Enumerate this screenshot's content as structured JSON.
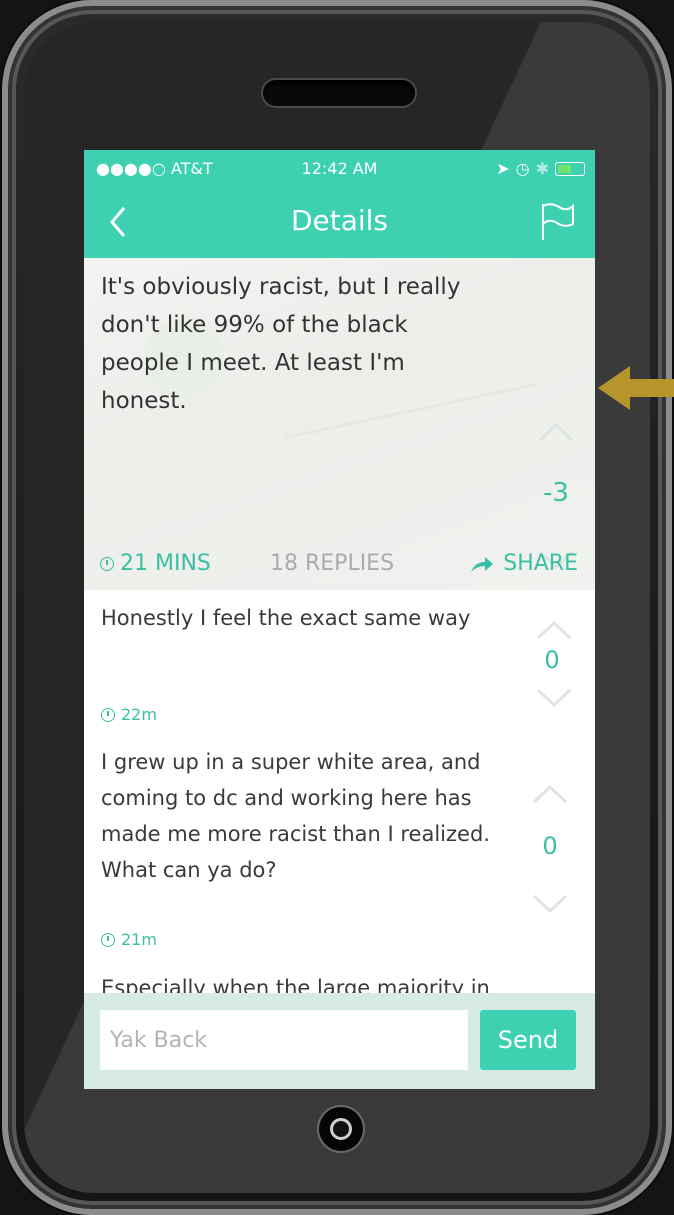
{
  "status_bar": {
    "carrier": "●●●●○ AT&T",
    "time": "12:42 AM"
  },
  "nav": {
    "title": "Details",
    "back_icon": "chevron-left-icon",
    "flag_icon": "flag-icon"
  },
  "post": {
    "text": "It's obviously racist, but I really don't like 99% of the black people I meet. At least I'm honest.",
    "votes": "-3",
    "time": "21 MINS",
    "replies": "18 REPLIES",
    "share": "SHARE"
  },
  "replies": [
    {
      "text": "Honestly I feel the exact same way",
      "votes": "0",
      "time": "22m"
    },
    {
      "text": "I grew up in a super white area, and coming to dc and working here has made me more racist than I realized. What can ya do?",
      "votes": "0",
      "time": "21m"
    },
    {
      "text": "Especially when the large majority in"
    }
  ],
  "compose": {
    "placeholder": "Yak Back",
    "send_label": "Send"
  },
  "colors": {
    "accent": "#3dd0b1",
    "vote_text": "#3bbfa4",
    "arrow": "#b8952a",
    "compose_bg": "#d8eae4"
  }
}
